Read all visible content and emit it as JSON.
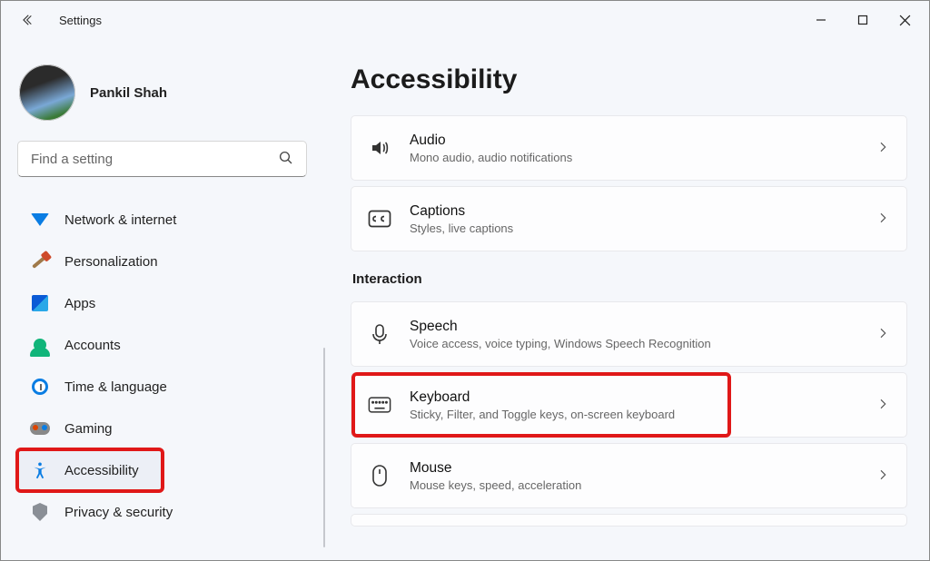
{
  "window": {
    "app_title": "Settings"
  },
  "profile": {
    "name": "Pankil Shah"
  },
  "search": {
    "placeholder": "Find a setting"
  },
  "sidebar": {
    "items": [
      {
        "id": "network",
        "label": "Network & internet"
      },
      {
        "id": "personalization",
        "label": "Personalization"
      },
      {
        "id": "apps",
        "label": "Apps"
      },
      {
        "id": "accounts",
        "label": "Accounts"
      },
      {
        "id": "time",
        "label": "Time & language"
      },
      {
        "id": "gaming",
        "label": "Gaming"
      },
      {
        "id": "accessibility",
        "label": "Accessibility"
      },
      {
        "id": "privacy",
        "label": "Privacy & security"
      }
    ],
    "selected_index": 6,
    "highlight_index": 6
  },
  "main": {
    "title": "Accessibility",
    "groups": [
      {
        "kind": "cards",
        "cards": [
          {
            "id": "audio",
            "icon": "audio-icon",
            "title": "Audio",
            "sub": "Mono audio, audio notifications"
          },
          {
            "id": "captions",
            "icon": "captions-icon",
            "title": "Captions",
            "sub": "Styles, live captions"
          }
        ]
      },
      {
        "kind": "section",
        "label": "Interaction",
        "cards": [
          {
            "id": "speech",
            "icon": "mic-icon",
            "title": "Speech",
            "sub": "Voice access, voice typing, Windows Speech Recognition"
          },
          {
            "id": "keyboard",
            "icon": "keyboard-icon",
            "title": "Keyboard",
            "sub": "Sticky, Filter, and Toggle keys, on-screen keyboard",
            "highlight": true
          },
          {
            "id": "mouse",
            "icon": "mouse-icon",
            "title": "Mouse",
            "sub": "Mouse keys, speed, acceleration"
          }
        ]
      }
    ]
  }
}
